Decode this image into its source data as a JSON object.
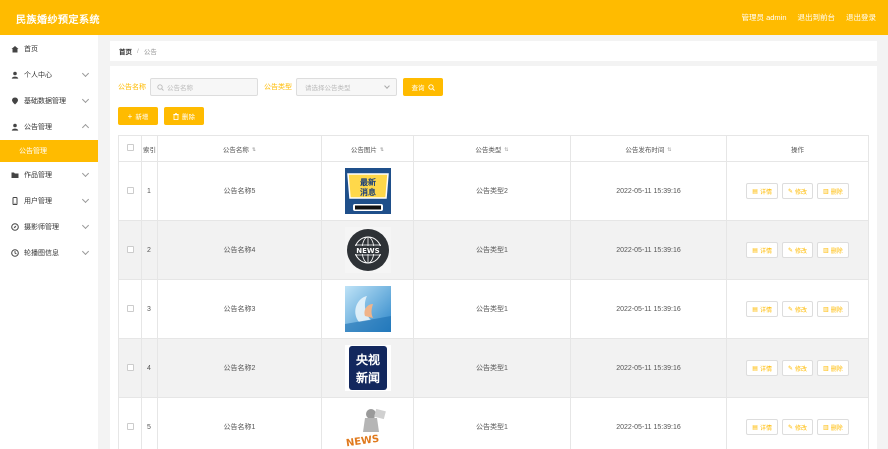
{
  "header": {
    "title": "民族婚纱预定系统",
    "nav": [
      "管理员 admin",
      "退出到前台",
      "退出登录"
    ],
    "accent": "#ffbb00"
  },
  "sidebar": {
    "items": [
      {
        "label": "首页",
        "icon": "home-icon",
        "chevron": false
      },
      {
        "label": "个人中心",
        "icon": "user-icon",
        "chevron": true
      },
      {
        "label": "基础数据管理",
        "icon": "pin-icon",
        "chevron": true
      },
      {
        "label": "公告管理",
        "icon": "person-icon",
        "chevron": true,
        "open": true
      },
      {
        "label": "作品管理",
        "icon": "folder-icon",
        "chevron": true
      },
      {
        "label": "用户管理",
        "icon": "phone-icon",
        "chevron": true
      },
      {
        "label": "摄影师管理",
        "icon": "compass-icon",
        "chevron": true
      },
      {
        "label": "轮播图信息",
        "icon": "clock-icon",
        "chevron": true
      }
    ],
    "active_sub": "公告管理"
  },
  "breadcrumb": {
    "home": "首页",
    "sep": "/",
    "current": "公告"
  },
  "search": {
    "name_label": "公告名称",
    "name_placeholder": "公告名称",
    "type_label": "公告类型",
    "type_placeholder": "请选择公告类型",
    "query_label": "查询"
  },
  "actions": {
    "add_label": "新增",
    "delete_label": "删除"
  },
  "table": {
    "headers": [
      "索引",
      "公告名称",
      "公告图片",
      "公告类型",
      "公告发布时间",
      "操作"
    ],
    "rows": [
      {
        "index": "1",
        "name": "公告名称5",
        "image": "breaking-news-icon",
        "type": "公告类型2",
        "time": "2022-05-11 15:39:16"
      },
      {
        "index": "2",
        "name": "公告名称4",
        "image": "globe-news-icon",
        "type": "公告类型1",
        "time": "2022-05-11 15:39:16"
      },
      {
        "index": "3",
        "name": "公告名称3",
        "image": "tech-news-icon",
        "type": "公告类型1",
        "time": "2022-05-11 15:39:16"
      },
      {
        "index": "4",
        "name": "公告名称2",
        "image": "cctv-news-icon",
        "type": "公告类型1",
        "time": "2022-05-11 15:39:16"
      },
      {
        "index": "5",
        "name": "公告名称1",
        "image": "news-figure-icon",
        "type": "公告类型1",
        "time": "2022-05-11 15:39:16"
      }
    ],
    "op_labels": {
      "detail": "详情",
      "edit": "修改",
      "delete": "删除"
    },
    "sort_icon": "sort-icon"
  },
  "thumb_text": {
    "breaking": [
      "最新",
      "消息"
    ],
    "news": "NEWS",
    "cctv": [
      "央视",
      "新闻"
    ]
  }
}
